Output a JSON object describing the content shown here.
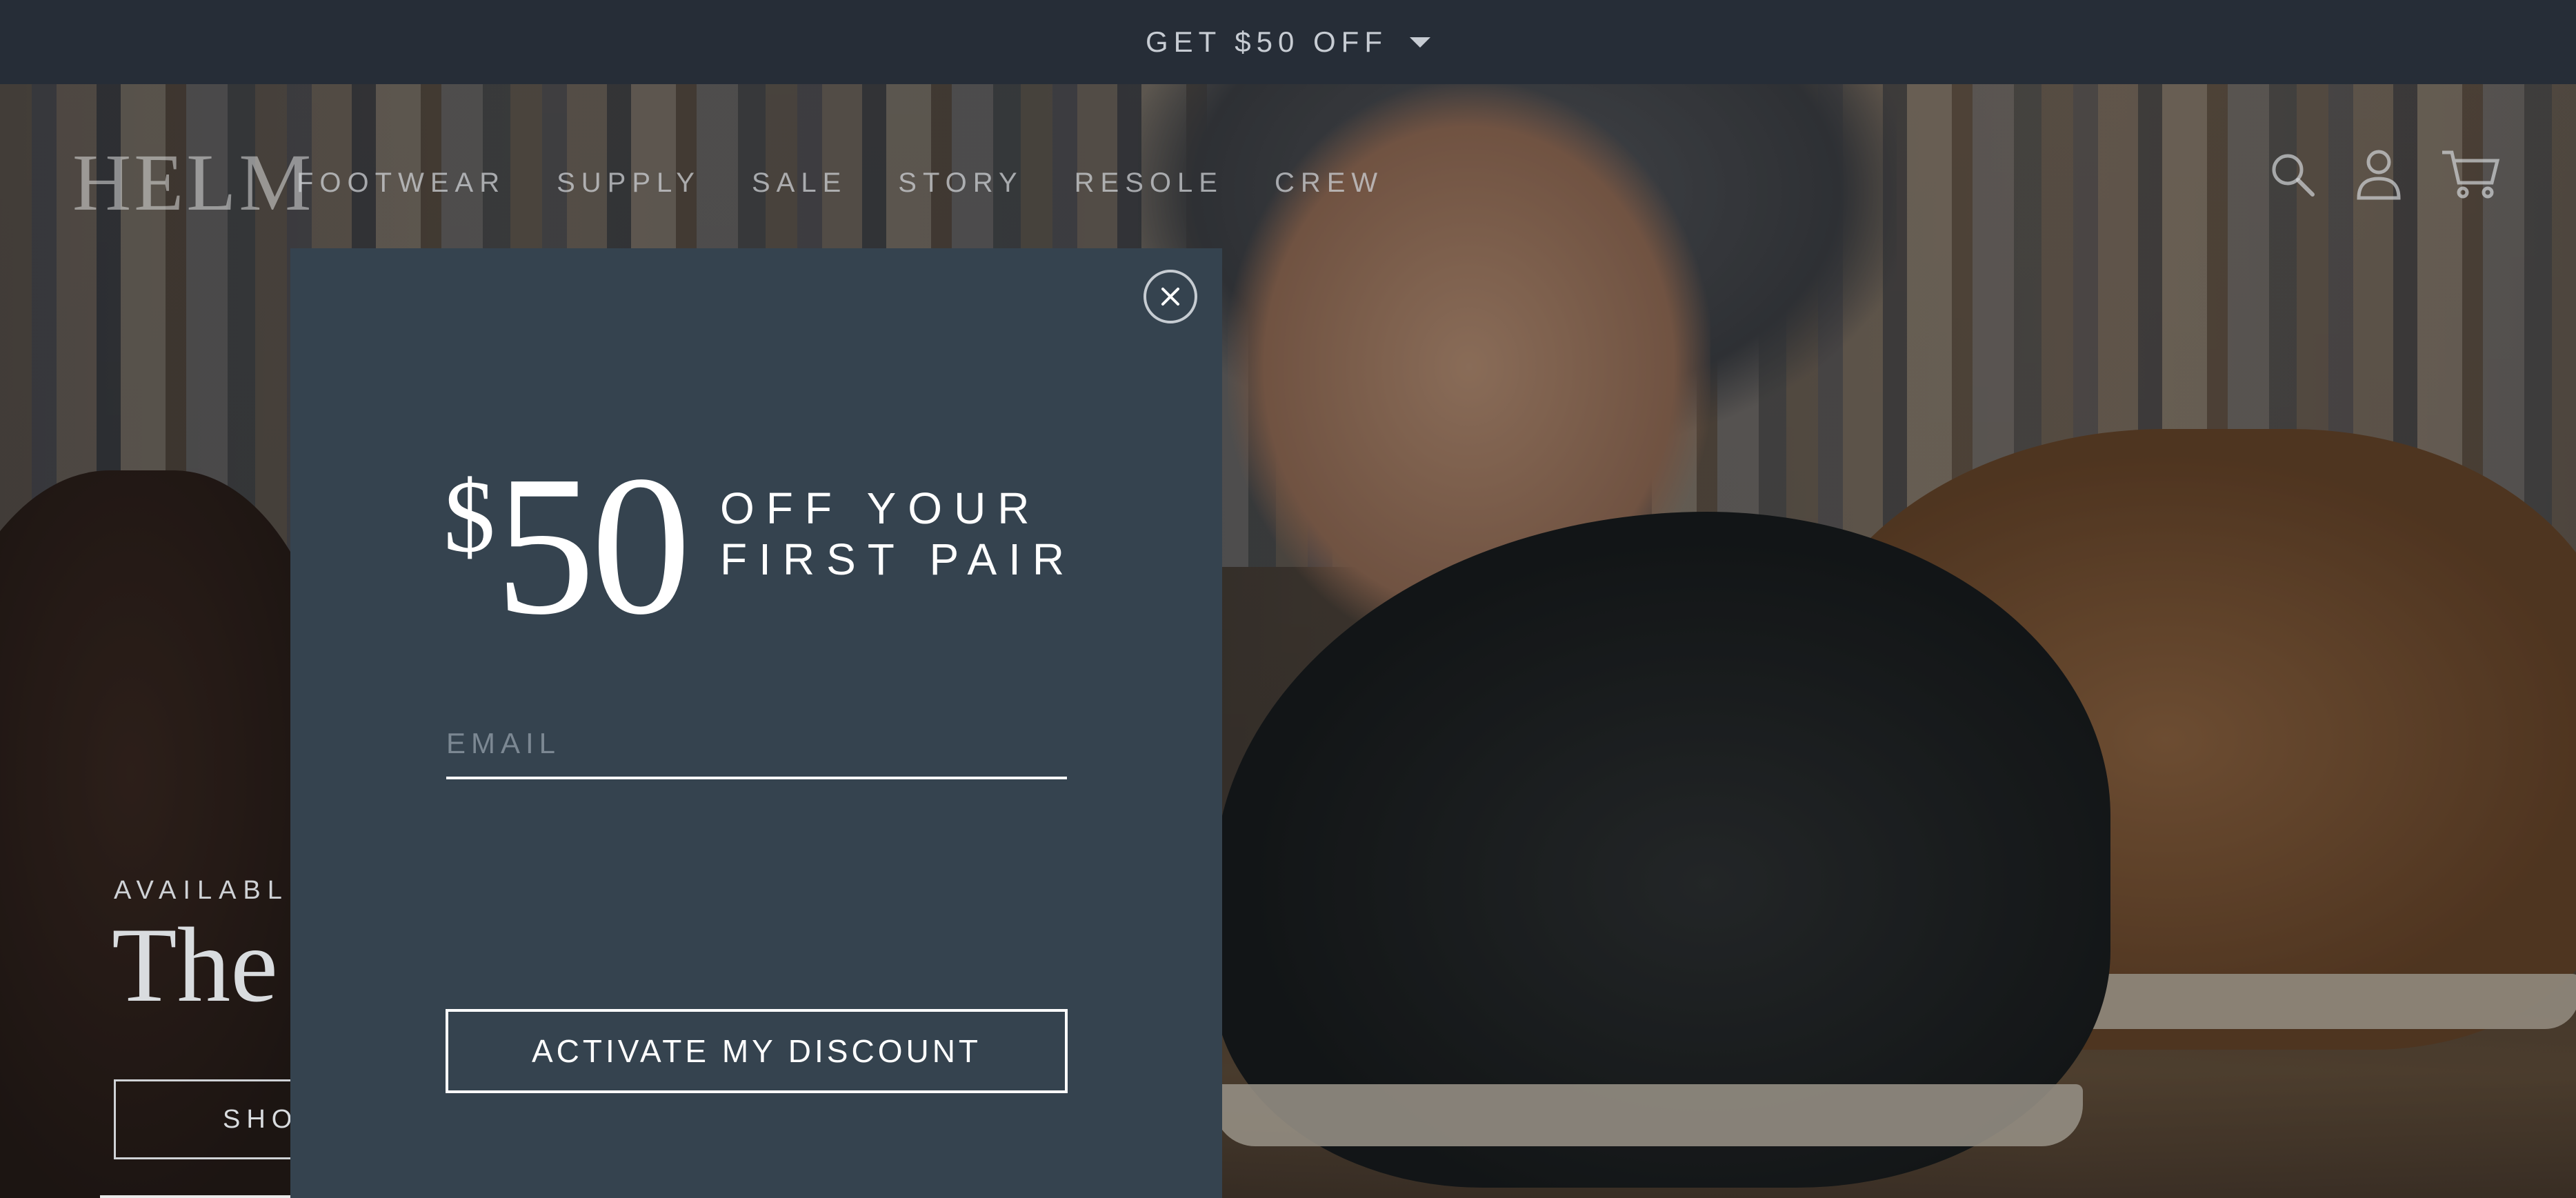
{
  "promo_bar": {
    "text": "GET $50 OFF",
    "caret_icon": "caret-down-icon"
  },
  "header": {
    "logo_text": "HELM",
    "nav": [
      {
        "label": "FOOTWEAR"
      },
      {
        "label": "SUPPLY"
      },
      {
        "label": "SALE"
      },
      {
        "label": "STORY"
      },
      {
        "label": "RESOLE"
      },
      {
        "label": "CREW"
      }
    ],
    "icons": [
      "search-icon",
      "account-icon",
      "cart-icon"
    ]
  },
  "hero": {
    "eyebrow": "AVAILABL",
    "title": "The",
    "cta_label": "SHO"
  },
  "modal": {
    "close_icon": "close-icon",
    "dollar_sign": "$",
    "amount": "50",
    "offer_line1": "OFF YOUR",
    "offer_line2": "FIRST PAIR",
    "email_placeholder": "EMAIL",
    "email_value": "",
    "submit_label": "ACTIVATE MY DISCOUNT"
  },
  "colors": {
    "promo_bar_bg": "#262d37",
    "modal_bg": "#35434f",
    "text_light": "#ffffff"
  }
}
